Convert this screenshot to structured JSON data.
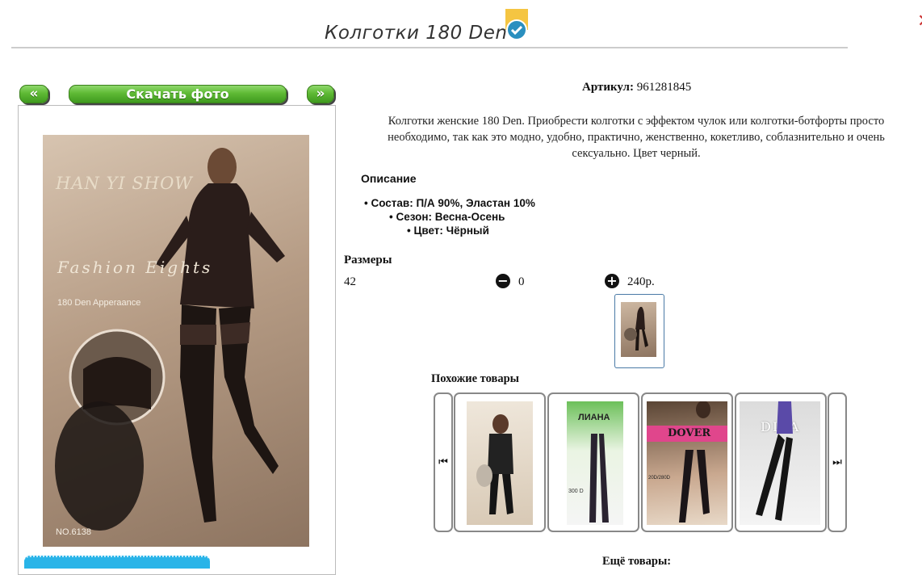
{
  "header": {
    "title": "Колготки 180 Den",
    "verified_icon": "check-badge-icon",
    "accent": "#f5c542"
  },
  "close_glyph": "✕",
  "gallery": {
    "prev_label": "«",
    "download_label": "Скачать фото",
    "next_label": "»",
    "photo": {
      "brand": "HAN YI SHOW",
      "script": "Fashion Eights",
      "subtitle": "180 Den Apperaance",
      "number": "NO.6138"
    }
  },
  "product": {
    "article_label": "Артикул:",
    "article_value": "961281845",
    "description": "Колготки женские 180 Den. Приобрести колготки с эффектом чулок или колготки-ботфорты просто необходимо, так как это модно, удобно, практично, женственно, кокетливо, соблазнительно и очень сексуально. Цвет черный.",
    "specs_heading": "Описание",
    "specs": [
      "Состав: П/А 90%, Эластан 10%",
      "Сезон: Весна-Осень",
      "Цвет: Чёрный"
    ],
    "sizes_heading": "Размеры",
    "size": "42",
    "quantity": "0",
    "price": "240р.",
    "minus_glyph": "−",
    "plus_glyph": "+"
  },
  "similar": {
    "heading": "Похожие товары",
    "prev_glyph": "⏮",
    "next_glyph": "⏭",
    "items": [
      {
        "brand": "",
        "caption": ""
      },
      {
        "brand": "ЛИАНА",
        "caption": "300 D"
      },
      {
        "brand": "DOVER",
        "caption": "20D/280D"
      },
      {
        "brand": "DIVA",
        "caption": ""
      }
    ]
  },
  "more_heading": "Ещё товары:"
}
